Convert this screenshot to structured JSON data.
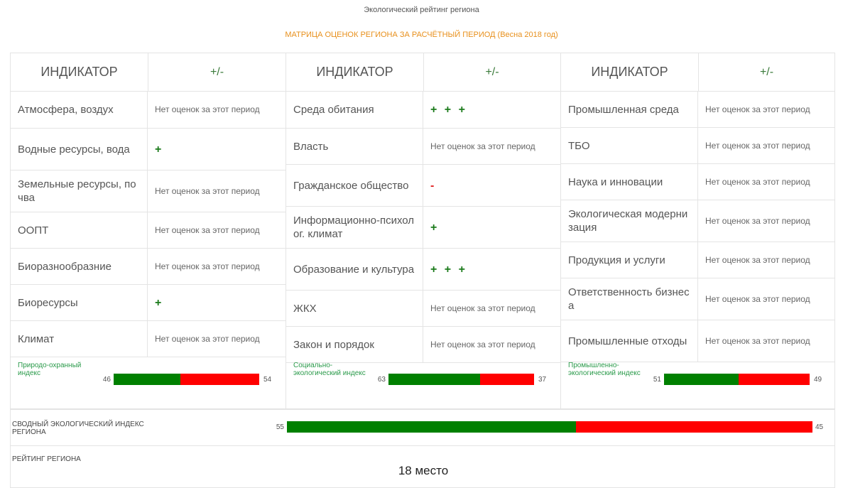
{
  "page_title": "Экологический рейтинг региона",
  "matrix_title": "МАТРИЦА ОЦЕНОК РЕГИОНА ЗА РАСЧЁТНЫЙ ПЕРИОД (Весна 2018 год)",
  "panels": [
    {
      "header_indicator": "ИНДИКАТОР",
      "header_mark": "+/-",
      "rows": [
        {
          "name": "Атмосфера, воздух",
          "value": "Нет оценок за этот период"
        },
        {
          "name": "Водные ресурсы, вода",
          "value": "+"
        },
        {
          "name": "Земельные ресурсы, почва",
          "value": "Нет оценок за этот период"
        },
        {
          "name": "ООПТ",
          "value": "Нет оценок за этот период"
        },
        {
          "name": "Биоразнообразние",
          "value": "Нет оценок за этот период"
        },
        {
          "name": "Биоресурсы",
          "value": "+"
        },
        {
          "name": "Климат",
          "value": "Нет оценок за этот период"
        }
      ],
      "index": {
        "label": "Природо-охранный индекс",
        "positive": 46,
        "negative": 54
      }
    },
    {
      "header_indicator": "ИНДИКАТОР",
      "header_mark": "+/-",
      "rows": [
        {
          "name": "Среда обитания",
          "value": "+ + +"
        },
        {
          "name": "Власть",
          "value": "Нет оценок за этот период"
        },
        {
          "name": "Гражданское общество",
          "value": "-"
        },
        {
          "name": "Информационно-психолог. климат",
          "value": "+"
        },
        {
          "name": "Образование и культура",
          "value": "+ + +"
        },
        {
          "name": "ЖКХ",
          "value": "Нет оценок за этот период"
        },
        {
          "name": "Закон и порядок",
          "value": "Нет оценок за этот период"
        }
      ],
      "index": {
        "label": "Социально-экологический индекс",
        "positive": 63,
        "negative": 37
      }
    },
    {
      "header_indicator": "ИНДИКАТОР",
      "header_mark": "+/-",
      "rows": [
        {
          "name": "Промышленная среда",
          "value": "Нет оценок за этот период"
        },
        {
          "name": "ТБО",
          "value": "Нет оценок за этот период"
        },
        {
          "name": "Наука и инновации",
          "value": "Нет оценок за этот период"
        },
        {
          "name": "Экологическая модернизация",
          "value": "Нет оценок за этот период"
        },
        {
          "name": "Продукция и услуги",
          "value": "Нет оценок за этот период"
        },
        {
          "name": "Ответственность бизнеса",
          "value": "Нет оценок за этот период"
        },
        {
          "name": "Промышленные отходы",
          "value": "Нет оценок за этот период"
        }
      ],
      "index": {
        "label": "Промышленно-экологический индекс",
        "positive": 51,
        "negative": 49
      }
    }
  ],
  "summary": {
    "label": "СВОДНЫЙ ЭКОЛОГИЧЕСКИЙ ИНДЕКС РЕГИОНА",
    "positive": 55,
    "negative": 45
  },
  "rating": {
    "label": "РЕЙТИНГ РЕГИОНА",
    "value": "18 место"
  },
  "colors": {
    "positive": "#008000",
    "negative": "#ff0000",
    "accent": "#e8901c",
    "index_label": "#2a9a4a"
  }
}
